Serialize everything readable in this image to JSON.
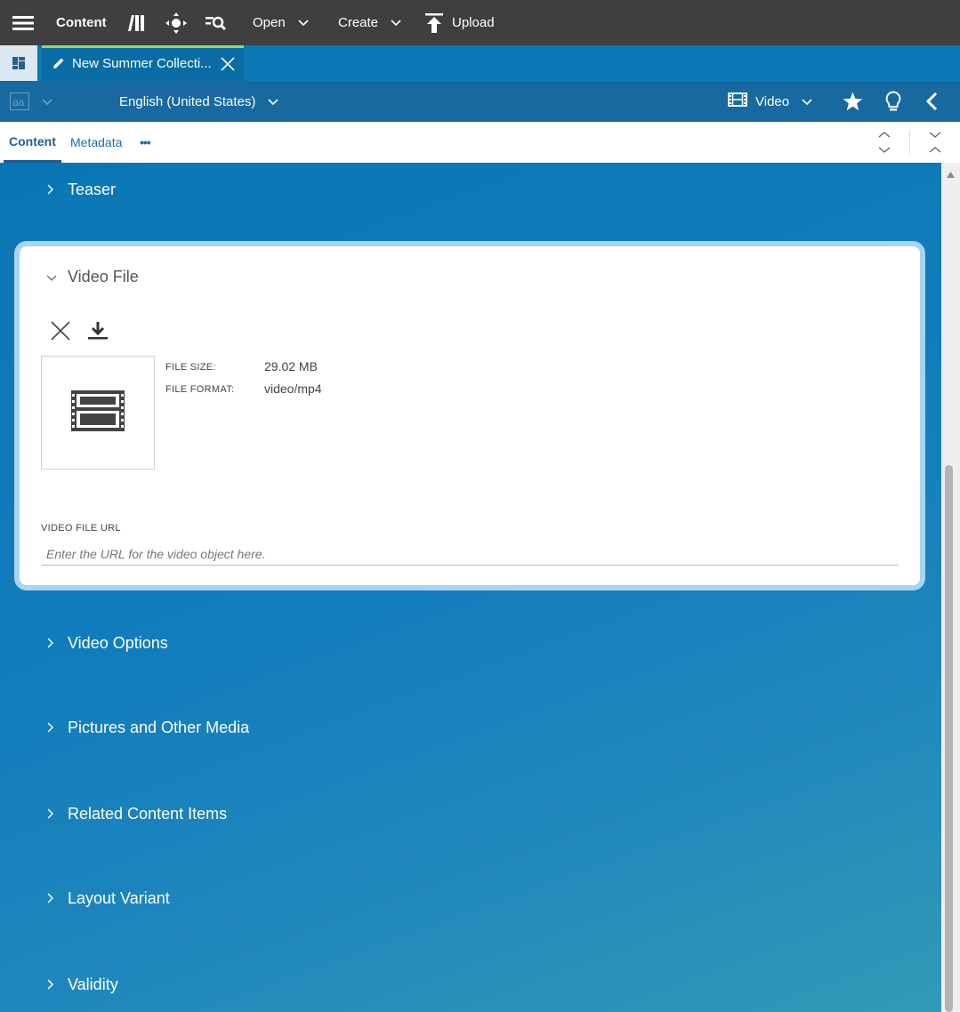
{
  "topbar": {
    "menu_icon": "hamburger-menu-icon",
    "app_title": "Content",
    "library_icon": "library-icon",
    "navigate_icon": "crosshair-icon",
    "search_icon": "search-list-icon",
    "open_label": "Open",
    "create_label": "Create",
    "upload_label": "Upload"
  },
  "tabs": {
    "dashboard_icon": "dashboard-icon",
    "active_tab_title": "New Summer Collecti...",
    "active_tab_accent": "#8fdc6b"
  },
  "toolbar": {
    "locale": "English (United States)",
    "doctype": "Video",
    "icons": [
      "translate-icon",
      "star-icon",
      "lightbulb-icon",
      "chevron-left-icon"
    ]
  },
  "form_tabs": {
    "content": "Content",
    "metadata": "Metadata",
    "more": "•••"
  },
  "sections": {
    "teaser": "Teaser",
    "video_file": "Video File",
    "video_options": "Video Options",
    "pictures": "Pictures and Other Media",
    "related": "Related Content Items",
    "layout": "Layout Variant",
    "validity": "Validity"
  },
  "video_file": {
    "size_label": "FILE SIZE:",
    "size_value": "29.02 MB",
    "format_label": "FILE FORMAT:",
    "format_value": "video/mp4",
    "url_label": "VIDEO FILE URL",
    "url_placeholder": "Enter the URL for the video object here.",
    "url_value": ""
  }
}
